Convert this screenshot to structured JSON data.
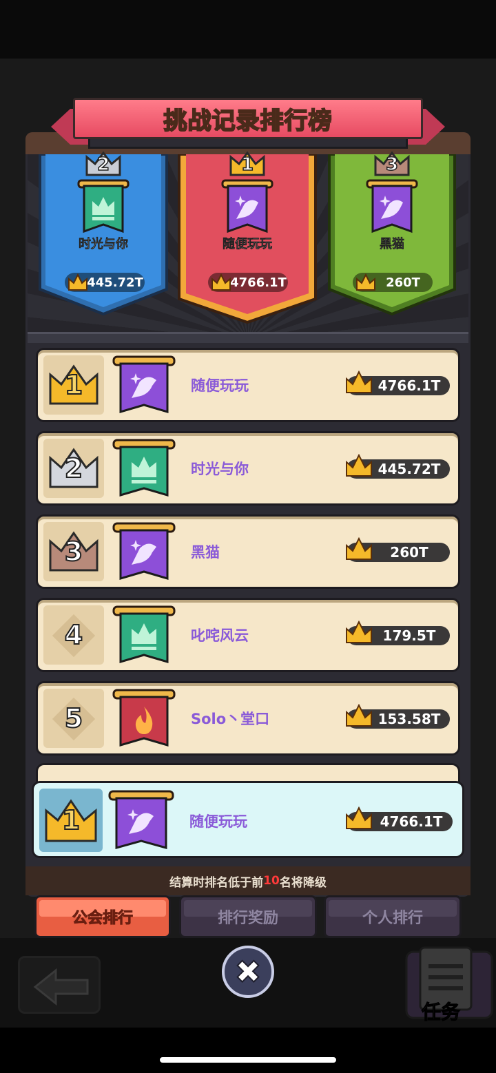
{
  "title": "挑战记录排行榜",
  "podium": [
    {
      "rank": "2",
      "name": "时光与你",
      "score": "445.72T",
      "emblem": "crown-banner-icon",
      "color": "#3a8ee0"
    },
    {
      "rank": "1",
      "name": "随便玩玩",
      "score": "4766.1T",
      "emblem": "bird-banner-icon",
      "color": "#e14f5e"
    },
    {
      "rank": "3",
      "name": "黑猫",
      "score": "260T",
      "emblem": "bird-banner-icon",
      "color": "#7fb83b"
    }
  ],
  "rows": [
    {
      "rank": "1",
      "name": "随便玩玩",
      "score": "4766.1T",
      "emblem": "bird-banner-icon"
    },
    {
      "rank": "2",
      "name": "时光与你",
      "score": "445.72T",
      "emblem": "crown-banner-icon"
    },
    {
      "rank": "3",
      "name": "黑猫",
      "score": "260T",
      "emblem": "bird-banner-icon"
    },
    {
      "rank": "4",
      "name": "叱咤风云",
      "score": "179.5T",
      "emblem": "crown-banner-icon"
    },
    {
      "rank": "5",
      "name": "Solo丶堂口",
      "score": "153.58T",
      "emblem": "flame-banner-icon"
    }
  ],
  "my_row": {
    "rank": "1",
    "name": "随便玩玩",
    "score": "4766.1T",
    "emblem": "bird-banner-icon"
  },
  "notice": {
    "pre": "结算时排名低于前",
    "num": "10",
    "post": "名将降级"
  },
  "tabs": {
    "guild": "公会排行",
    "reward": "排行奖励",
    "personal": "个人排行"
  },
  "task_label": "任务",
  "close_symbol": "✖",
  "colors": {
    "accent": "#e85e42",
    "name_text": "#8a5ad8",
    "gold": "#f5b92a"
  }
}
